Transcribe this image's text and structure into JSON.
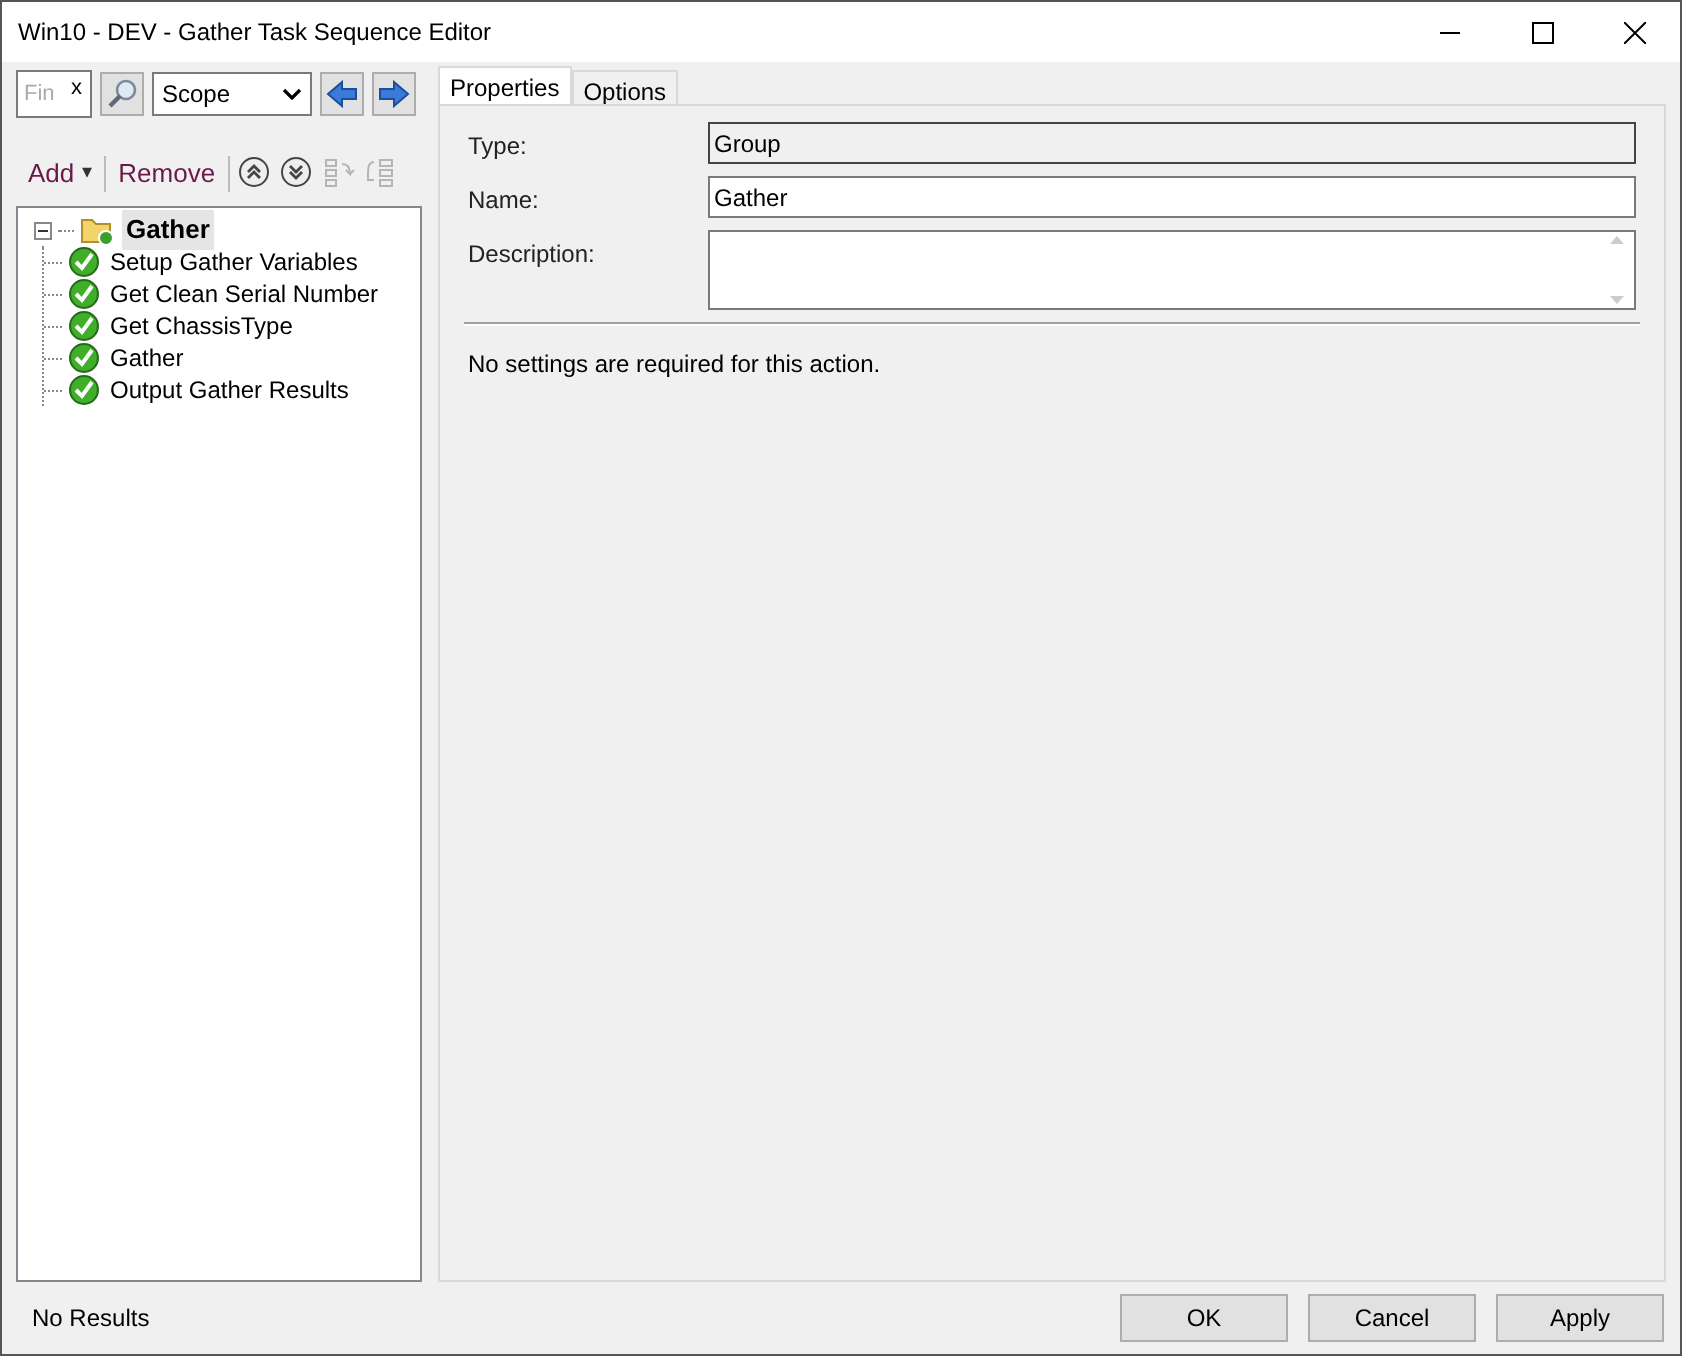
{
  "window": {
    "title": "Win10 - DEV - Gather Task Sequence Editor"
  },
  "find": {
    "placeholder": "Fin",
    "clear": "x",
    "scope": "Scope"
  },
  "toolbar": [
    {
      "kind": "menu",
      "label": "Add",
      "caret": "▾"
    },
    {
      "kind": "text",
      "label": "Remove"
    },
    {
      "kind": "up",
      "disabled": false
    },
    {
      "kind": "down",
      "disabled": false
    },
    {
      "kind": "outdent",
      "disabled": true
    },
    {
      "kind": "indent",
      "disabled": true
    }
  ],
  "tree": [
    {
      "label": "Gather",
      "kind": "group",
      "selected": true,
      "expanded": true,
      "children": [
        {
          "label": "Setup Gather Variables",
          "kind": "step",
          "selected": false
        },
        {
          "label": "Get Clean Serial Number",
          "kind": "step",
          "selected": false
        },
        {
          "label": "Get ChassisType",
          "kind": "step",
          "selected": false
        },
        {
          "label": "Gather",
          "kind": "step",
          "selected": false
        },
        {
          "label": "Output Gather Results",
          "kind": "step",
          "selected": false
        }
      ]
    }
  ],
  "tabs": [
    {
      "label": "Properties",
      "selected": true
    },
    {
      "label": "Options",
      "selected": false
    }
  ],
  "fields": [
    {
      "label": "Type:",
      "value": "Group",
      "kind": "readonly"
    },
    {
      "label": "Name:",
      "value": "Gather",
      "kind": "text"
    },
    {
      "label": "Description:",
      "kind": "multiline"
    }
  ],
  "message": "No settings are required  for this action.",
  "status": "No Results",
  "buttons": [
    "OK",
    "Cancel",
    "Apply"
  ]
}
